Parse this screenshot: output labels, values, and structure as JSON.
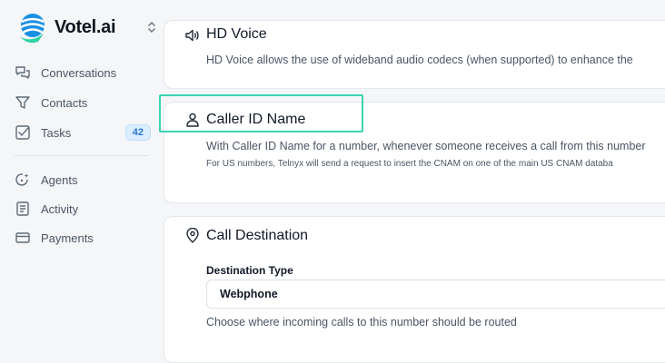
{
  "brand": {
    "name": "Votel.ai"
  },
  "sidebar": {
    "items": [
      {
        "label": "Conversations",
        "icon": "chat-bubbles-icon"
      },
      {
        "label": "Contacts",
        "icon": "filter-icon"
      },
      {
        "label": "Tasks",
        "icon": "checkbox-icon",
        "badge": "42"
      },
      {
        "label": "Agents",
        "icon": "agent-spark-icon"
      },
      {
        "label": "Activity",
        "icon": "activity-doc-icon"
      },
      {
        "label": "Payments",
        "icon": "credit-card-icon"
      }
    ]
  },
  "hd_voice": {
    "title": "HD Voice",
    "description": "HD Voice allows the use of wideband audio codecs (when supported) to enhance the"
  },
  "caller_id": {
    "title": "Caller ID Name",
    "description": "With Caller ID Name for a number, whenever someone receives a call from this number",
    "note": "For US numbers, Telnyx will send a request to insert the CNAM on one of the main US CNAM databa"
  },
  "call_destination": {
    "title": "Call Destination",
    "field_label": "Destination Type",
    "selected_value": "Webphone",
    "help": "Choose where incoming calls to this number should be routed"
  },
  "colors": {
    "accent": "#3ad4b0",
    "badge_bg": "#dbeeff",
    "badge_text": "#2b7bd0"
  }
}
